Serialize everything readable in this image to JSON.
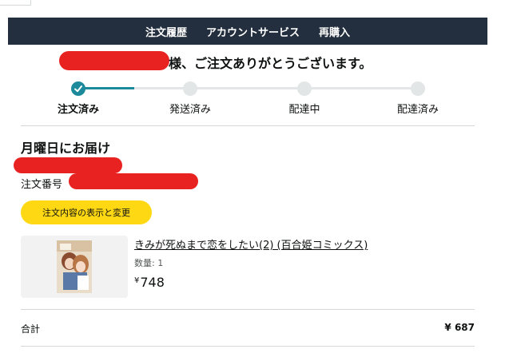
{
  "nav": {
    "items": [
      "注文履歴",
      "アカウントサービス",
      "再購入"
    ]
  },
  "greeting": {
    "suffix": "様、ご注文ありがとうございます。"
  },
  "tracker": {
    "steps": [
      {
        "label": "注文済み",
        "state": "done"
      },
      {
        "label": "発送済み",
        "state": "pending"
      },
      {
        "label": "配達中",
        "state": "pending"
      },
      {
        "label": "配達済み",
        "state": "pending"
      }
    ],
    "accent": "#1c8a9b"
  },
  "delivery": {
    "title": "月曜日にお届け"
  },
  "order": {
    "number_label": "注文番号"
  },
  "actions": {
    "view_edit_label": "注文内容の表示と変更"
  },
  "product": {
    "title": "きみが死ぬまで恋をしたい(2) (百合姫コミックス)",
    "quantity": "数量: 1",
    "price_symbol": "¥",
    "price_value": "748"
  },
  "total": {
    "label": "合計",
    "value": "¥ 687"
  },
  "colors": {
    "navbar": "#232f3e",
    "button": "#ffd814",
    "redaction": "#e82121"
  }
}
